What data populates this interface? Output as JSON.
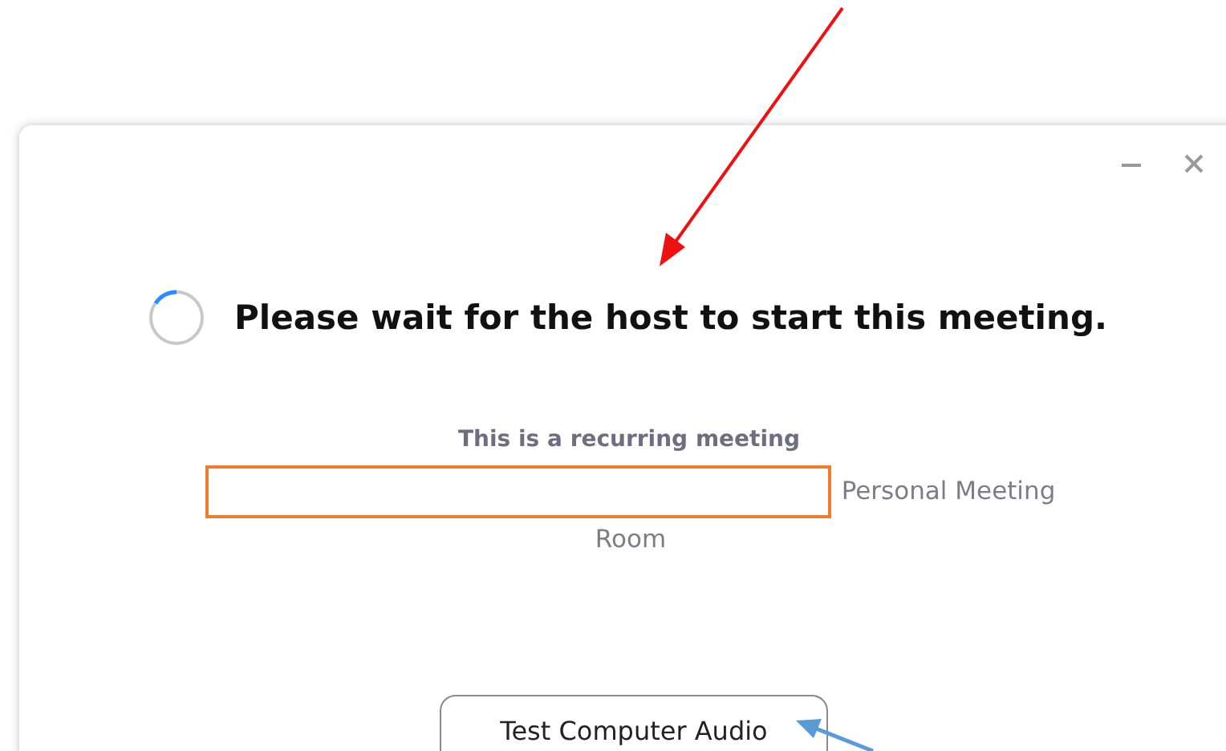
{
  "dialog": {
    "headline": "Please wait for the host to start this meeting.",
    "recurring_label": "This is a recurring meeting",
    "room_label": "Personal Meeting Room",
    "buttons": [
      "Test Computer Audio"
    ]
  }
}
